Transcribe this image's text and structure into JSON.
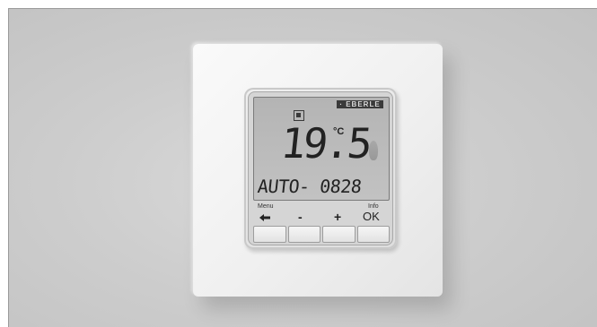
{
  "thermostat": {
    "brand_label": "· EBERLE",
    "temperature": "19.5",
    "temperature_unit": "°C",
    "status_text": "AUTO- 0828",
    "labels": {
      "menu": "Menu",
      "info": "Info",
      "minus": "-",
      "plus": "+",
      "ok": "OK"
    },
    "icons": [
      "mode-square-icon",
      "flame-icon",
      "arrow-left-icon"
    ]
  },
  "colors": {
    "background": "#cdcdcd",
    "plate": "#f0f0f0",
    "lcd": "#bcbcbc",
    "segments": "#222222"
  }
}
